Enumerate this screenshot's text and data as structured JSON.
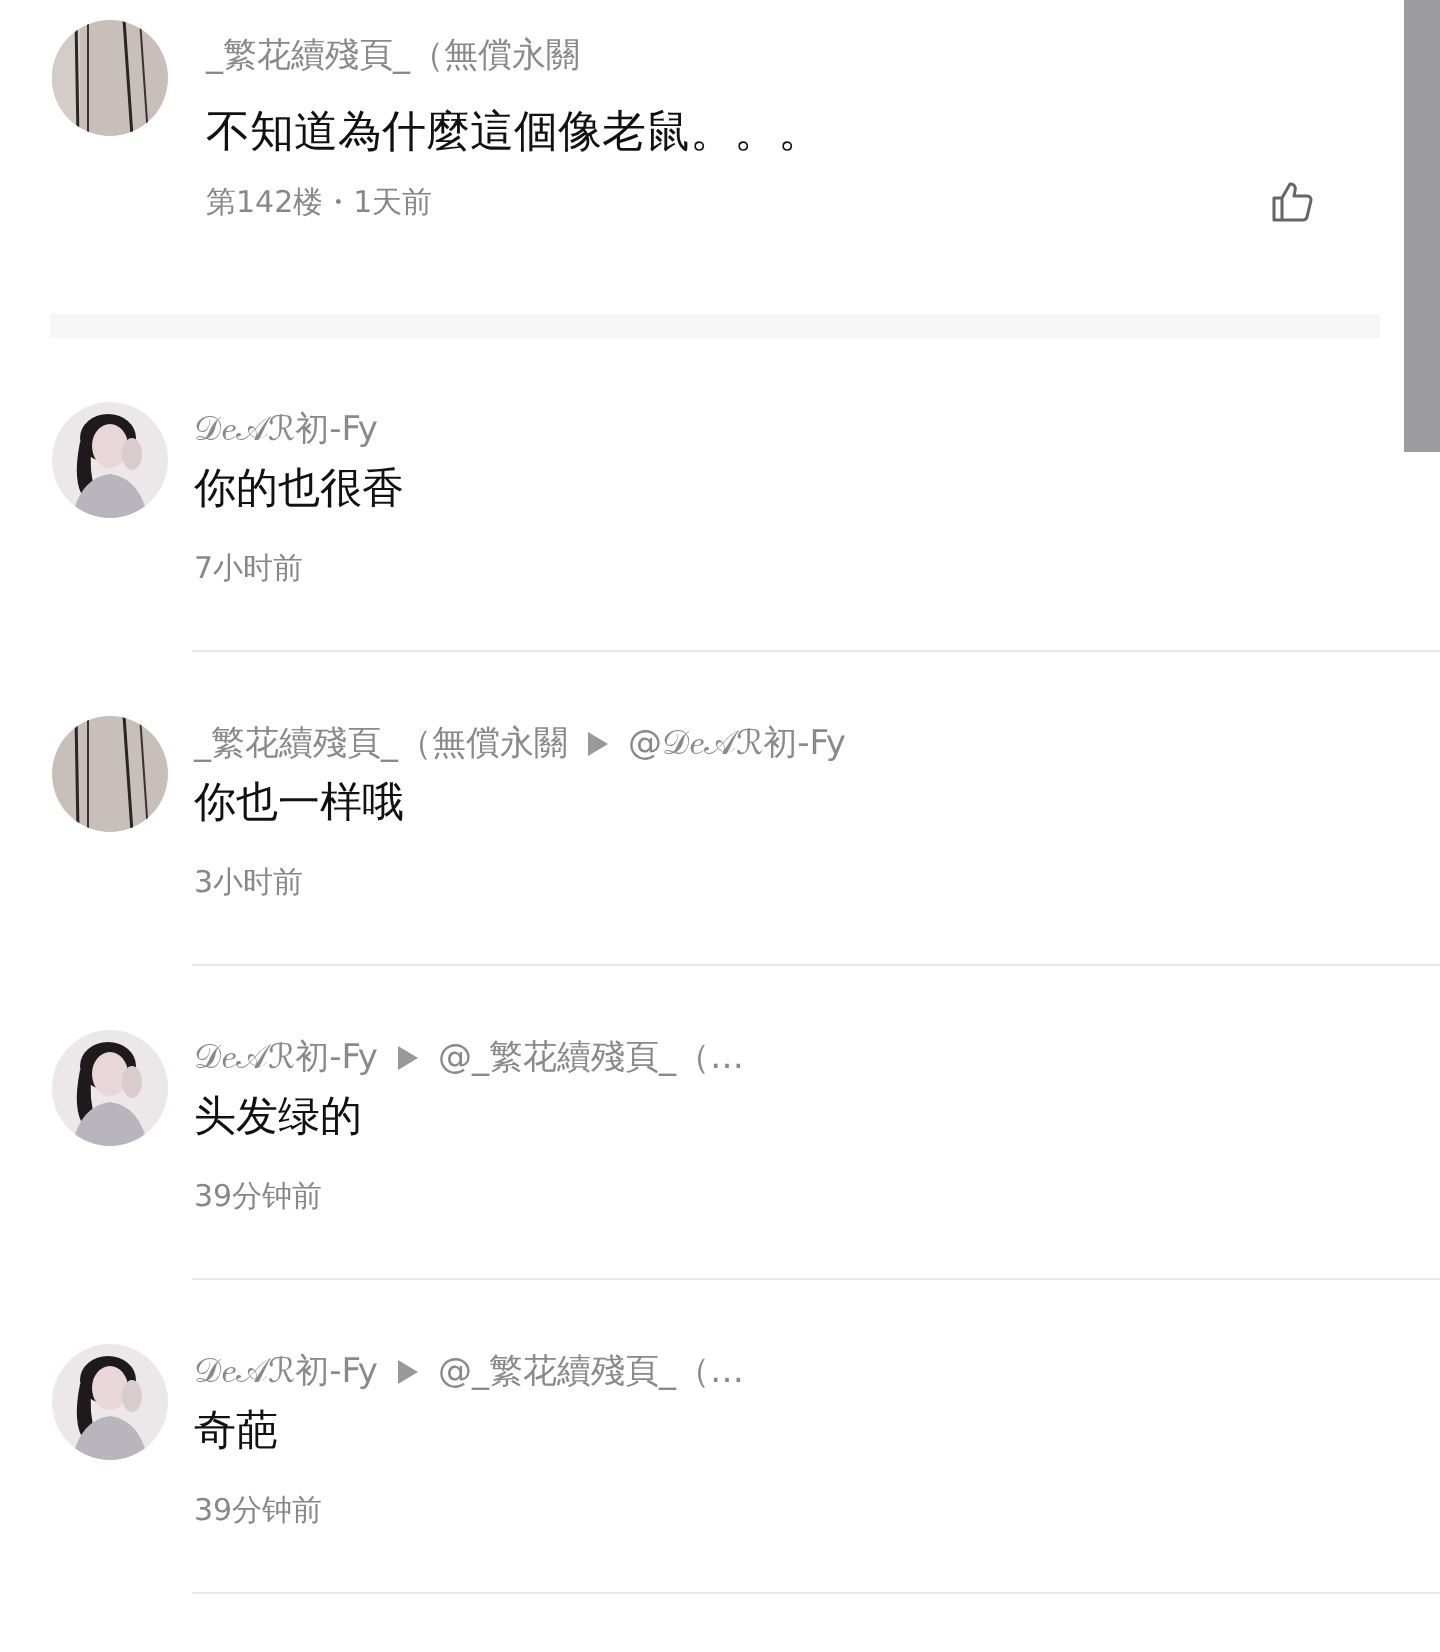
{
  "post": {
    "author": "_繁花續殘頁_（無償永關",
    "text": "不知道為什麼這個像老鼠。。。",
    "meta": "第142楼・1天前"
  },
  "replies": [
    {
      "author": "𝒟𝑒𝒜ℛ初-Fy",
      "text": "你的也很香",
      "time": "7小时前"
    },
    {
      "author": "_繁花續殘頁_（無償永關",
      "reply_to": "@𝒟𝑒𝒜ℛ初-Fy",
      "text": "你也一样哦",
      "time": "3小时前"
    },
    {
      "author": "𝒟𝑒𝒜ℛ初-Fy",
      "reply_to": "@_繁花續殘頁_（…",
      "text": "头发绿的",
      "time": "39分钟前"
    },
    {
      "author": "𝒟𝑒𝒜ℛ初-Fy",
      "reply_to": "@_繁花續殘頁_（…",
      "text": "奇葩",
      "time": "39分钟前"
    }
  ]
}
